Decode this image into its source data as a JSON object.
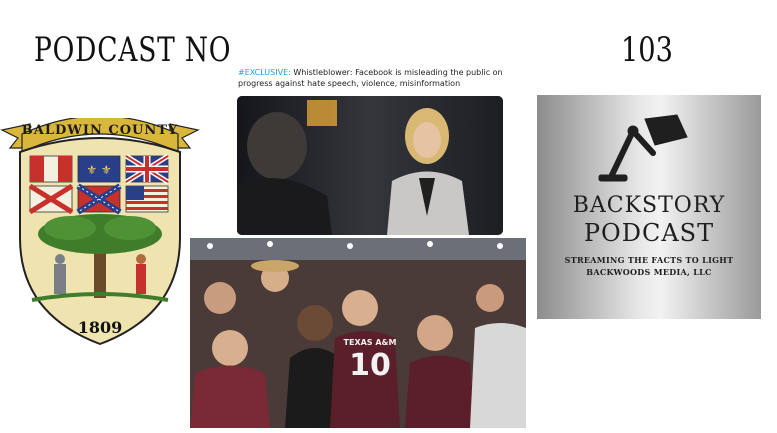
{
  "slide": {
    "title_left": "PODCAST NO",
    "title_right": "103"
  },
  "seal": {
    "county": "BALDWIN COUNTY",
    "year": "1809",
    "colors": {
      "gold": "#d9b73a",
      "shield": "#efe3b0",
      "tree": "#3f7d2a",
      "red": "#c8302c",
      "blue": "#2a3f8a"
    }
  },
  "news": {
    "tag": "#EXCLUSIVE:",
    "headline": " Whistleblower: Facebook is misleading the public on progress against hate speech, violence, misinformation"
  },
  "poster": {
    "title_line1": "BACKSTORY",
    "title_line2": "PODCAST",
    "tagline_line1": "STREAMING THE FACTS TO LIGHT",
    "tagline_line2": "BACKWOODS MEDIA, LLC",
    "icon": "desk-lamp-icon"
  },
  "photo_bottom": {
    "jersey_text": "TEXAS A&M",
    "jersey_number": "10"
  }
}
